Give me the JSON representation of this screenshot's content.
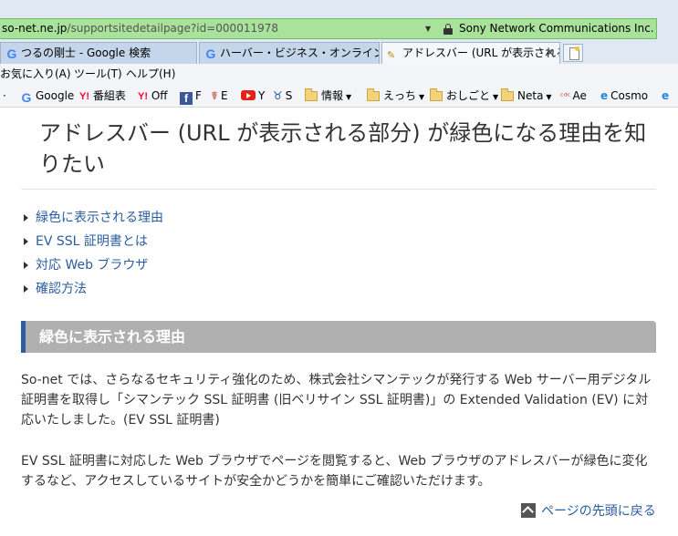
{
  "address_bar": {
    "domain": "so-net.ne.jp",
    "path": "/supportsitedetailpage?id=000011978",
    "cert_owner": "Sony Network Communications Inc. [JP]"
  },
  "tabs": [
    {
      "label": "つるの剛士 - Google 検索",
      "icon": "google-icon"
    },
    {
      "label": "ハーバー・ビジネス・オンライン - Goo...",
      "icon": "google-icon"
    },
    {
      "label": "アドレスバー (URL が表示される...",
      "icon": "so-net-icon",
      "active": true
    }
  ],
  "menu": [
    "お気に入り(A)",
    "ツール(T)",
    "ヘルプ(H)"
  ],
  "favorites": [
    {
      "label": "Google",
      "icon": "google-icon"
    },
    {
      "label": "番組表",
      "icon": "yahoo-icon"
    },
    {
      "label": "Off",
      "icon": "yahoo-icon"
    },
    {
      "label": "F",
      "icon": "facebook-icon"
    },
    {
      "label": "E",
      "icon": "ebay-icon"
    },
    {
      "label": "Y",
      "icon": "youtube-icon"
    },
    {
      "label": "S",
      "icon": "s-icon"
    },
    {
      "label": "情報",
      "icon": "folder-icon"
    },
    {
      "label": "えっち",
      "icon": "folder-icon"
    },
    {
      "label": "おしごと",
      "icon": "folder-icon"
    },
    {
      "label": "Neta",
      "icon": "folder-icon"
    },
    {
      "label": "Ae",
      "icon": "ae-icon"
    },
    {
      "label": "Cosmo",
      "icon": "ie-icon"
    }
  ],
  "page": {
    "title": "アドレスバー (URL が表示される部分) が緑色になる理由を知りたい",
    "toc": [
      "緑色に表示される理由",
      "EV SSL 証明書とは",
      "対応 Web ブラウザ",
      "確認方法"
    ],
    "section_heading": "緑色に表示される理由",
    "paragraph1": "So-net では、さらなるセキュリティ強化のため、株式会社シマンテックが発行する Web サーバー用デジタル証明書を取得し「シマンテック SSL 証明書 (旧ベリサイン SSL 証明書)」の Extended Validation (EV) に対応いたしました。(EV SSL 証明書)",
    "paragraph2": "EV SSL 証明書に対応した Web ブラウザでページを閲覧すると、Web ブラウザのアドレスバーが緑色に変化するなど、アクセスしているサイトが安全かどうかを簡単にご確認いただけます。",
    "back_to_top": "ページの先頭に戻る"
  },
  "colors": {
    "address_bar_green": "#a9e29b",
    "link_blue": "#2a5d9f",
    "section_bar_gray": "#b0b0b0",
    "section_accent": "#2f5c9e"
  }
}
